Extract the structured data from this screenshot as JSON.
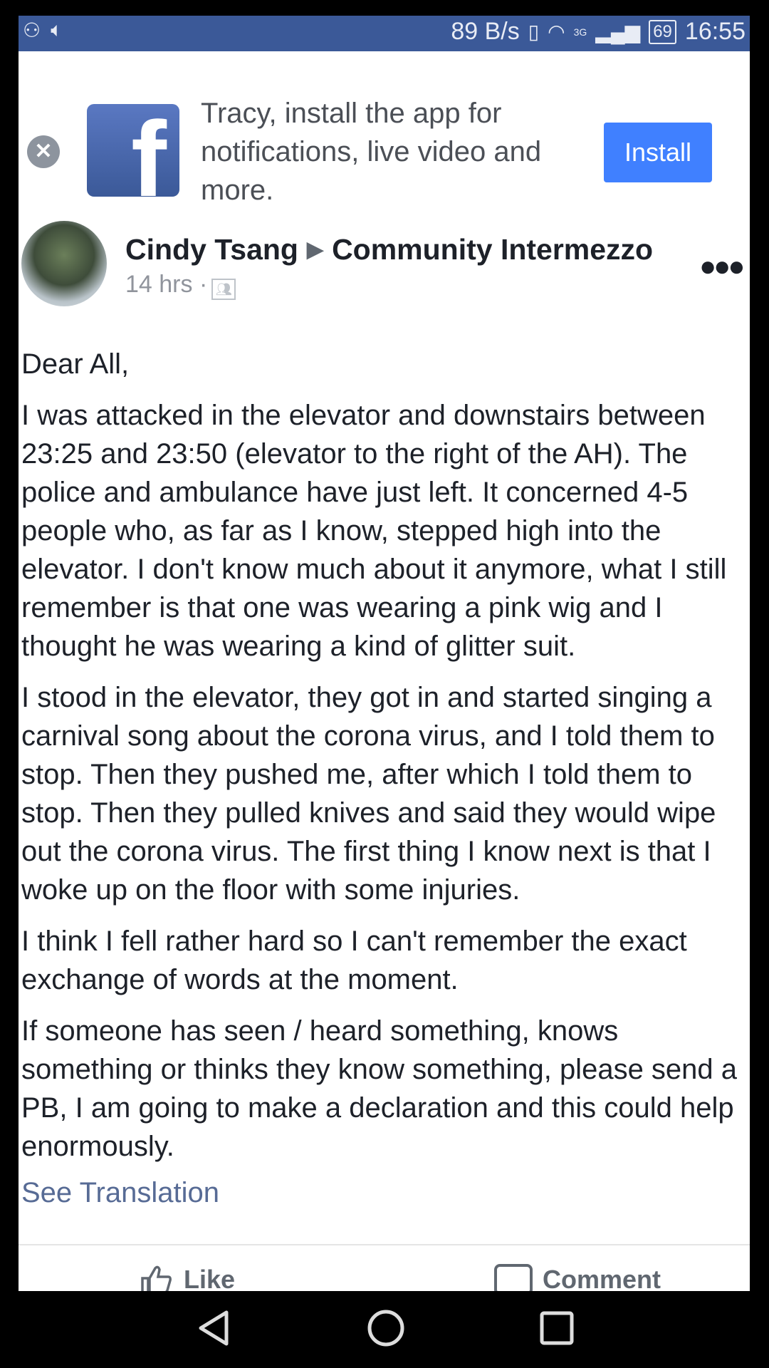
{
  "status_bar": {
    "network_speed": "89 B/s",
    "signal_label": "3G",
    "battery": "69",
    "time": "16:55"
  },
  "banner": {
    "message": "Tracy, install the app for notifications, live video and more.",
    "install_label": "Install",
    "close_glyph": "✕",
    "logo_glyph": "f"
  },
  "post": {
    "author": "Cindy Tsang",
    "group": "Community Intermezzo",
    "time_ago": "14 hrs ·",
    "paragraphs": [
      "Dear All,",
      "I was attacked in the elevator and downstairs between 23:25 and 23:50 (elevator to the right of the AH). The police and ambulance have just left. It concerned 4-5 people who, as far as I know, stepped high into the elevator. I don't know much about it anymore, what I still remember is that one was wearing a pink wig and I thought he was wearing a kind of glitter suit.",
      "I stood in the elevator, they got in and started singing a carnival song about the corona virus, and I told them to stop. Then they pushed me, after which I told them to stop. Then they pulled knives and said they would wipe out the corona virus. The first thing I know next is that I woke up on the floor with some injuries.",
      "I think I fell rather hard so I can't remember the exact exchange of words at the moment.",
      "If someone has seen / heard something, knows something or thinks they know something, please send a PB, I am going to make a declaration and this could help enormously."
    ],
    "see_translation": "See Translation"
  },
  "actions": {
    "like_label": "Like",
    "comment_label": "Comment"
  },
  "colors": {
    "status_bar": "#3b5998",
    "install_button": "#4080ff",
    "link": "#576b95"
  }
}
